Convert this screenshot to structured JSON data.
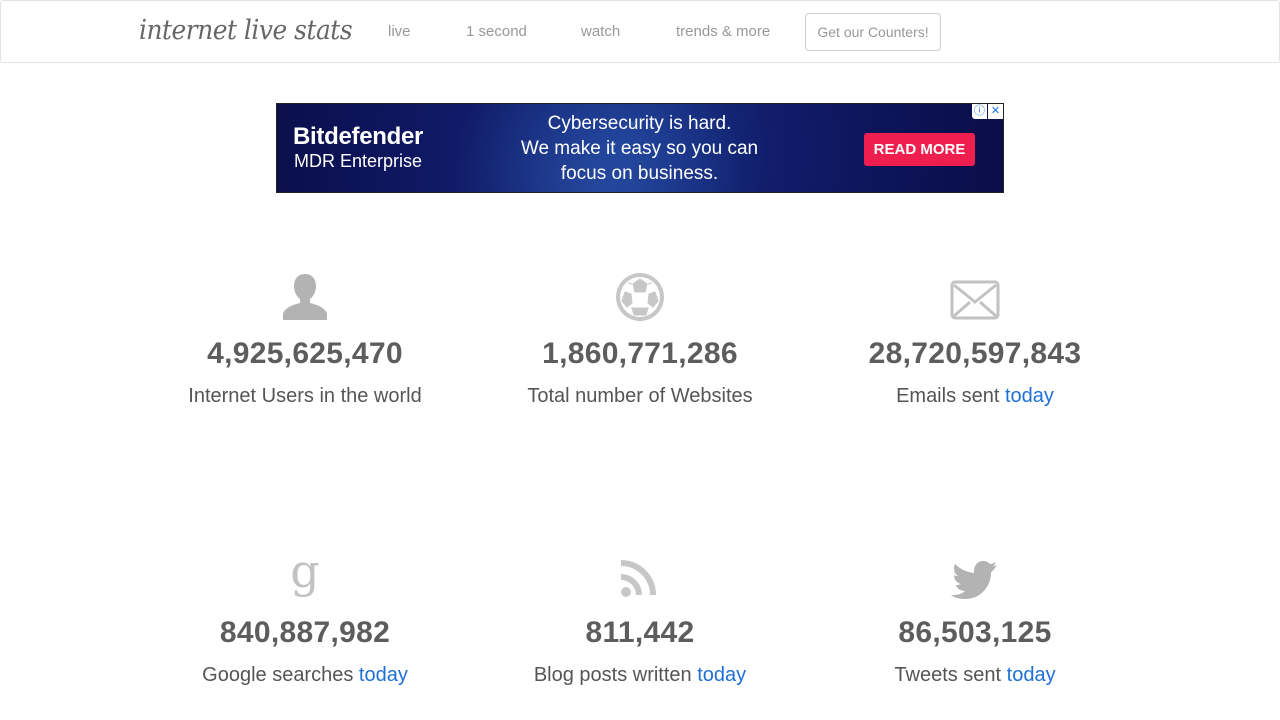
{
  "nav": {
    "brand": "internet live stats",
    "links": [
      "live",
      "1 second",
      "watch",
      "trends & more"
    ],
    "cta": "Get our Counters!"
  },
  "ad": {
    "brand": "Bitdefender",
    "product": "MDR Enterprise",
    "headline": "Cybersecurity is hard.",
    "line2": "We make it easy so you can",
    "line3": "focus on business.",
    "cta": "READ MORE",
    "info_icon": "ⓘ",
    "close_icon": "✕"
  },
  "stats": [
    {
      "icon": "user-icon",
      "value": "4,925,625,470",
      "label": "Internet Users in the world",
      "suffix": ""
    },
    {
      "icon": "globe-icon",
      "value": "1,860,771,286",
      "label": "Total number of Websites",
      "suffix": ""
    },
    {
      "icon": "envelope-icon",
      "value": "28,720,597,843",
      "label": "Emails sent",
      "suffix": "today"
    },
    {
      "icon": "google-icon",
      "value": "840,887,982",
      "label": "Google searches",
      "suffix": "today"
    },
    {
      "icon": "rss-icon",
      "value": "811,442",
      "label": "Blog posts written",
      "suffix": "today"
    },
    {
      "icon": "twitter-icon",
      "value": "86,503,125",
      "label": "Tweets sent",
      "suffix": "today"
    }
  ],
  "colors": {
    "link": "#1e6fd9",
    "icon": "#b3b3b3",
    "number": "#5d5d5d",
    "ad_cta": "#ee1f4f"
  }
}
